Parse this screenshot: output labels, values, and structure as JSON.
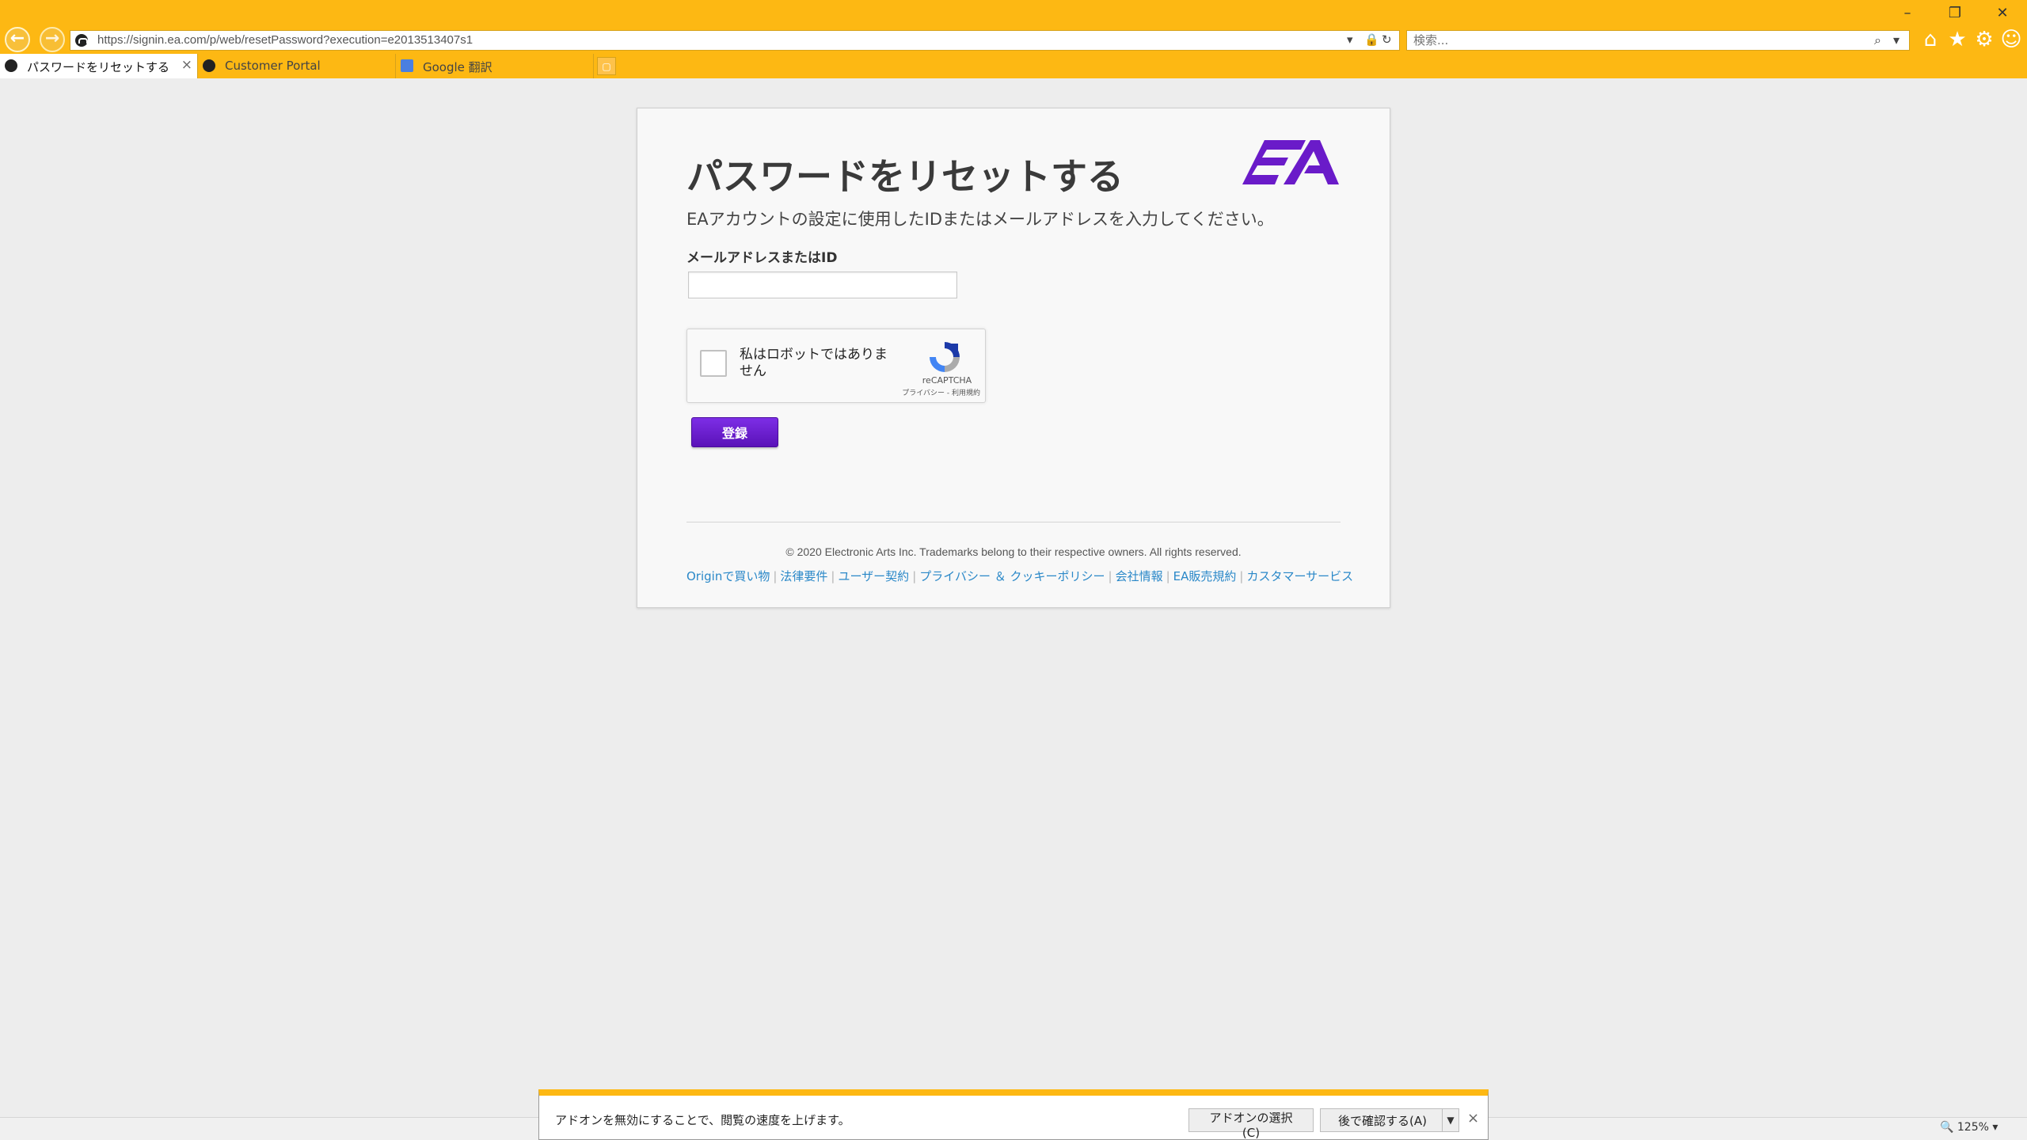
{
  "browser": {
    "url": "https://signin.ea.com/p/web/resetPassword?execution=e2013513407s1",
    "search_placeholder": "検索...",
    "tabs": [
      {
        "label": "パスワードをリセットする",
        "active": true
      },
      {
        "label": "Customer Portal",
        "active": false
      },
      {
        "label": "Google 翻訳",
        "active": false
      }
    ],
    "zoom": "125%",
    "icons": [
      "back-arrow-icon",
      "forward-arrow-icon",
      "lock-icon",
      "refresh-icon",
      "search-icon",
      "home-icon",
      "star-icon",
      "gear-icon",
      "smiley-icon"
    ]
  },
  "page": {
    "title": "パスワードをリセットする",
    "subtitle": "EAアカウントの設定に使用したIDまたはメールアドレスを入力してください。",
    "field_label": "メールアドレスまたはID",
    "email_value": "",
    "captcha": {
      "label": "私はロボットではありません",
      "brand": "reCAPTCHA",
      "links": "プライバシー - 利用規約"
    },
    "submit_label": "登録",
    "copyright": "© 2020 Electronic Arts Inc. Trademarks belong to their respective owners. All rights reserved.",
    "footer_links": [
      "Originで買い物",
      "法律要件",
      "ユーザー契約",
      "プライバシー ＆ クッキーポリシー",
      "会社情報",
      "EA販売規約",
      "カスタマーサービス"
    ],
    "colors": {
      "chrome": "#fdb813",
      "ea_purple": "#6a1bc9",
      "link": "#2a88c8"
    }
  },
  "notification": {
    "text": "アドオンを無効にすることで、閲覧の速度を上げます。",
    "choose_label": "アドオンの選択(C)",
    "later_label": "後で確認する(A)"
  }
}
